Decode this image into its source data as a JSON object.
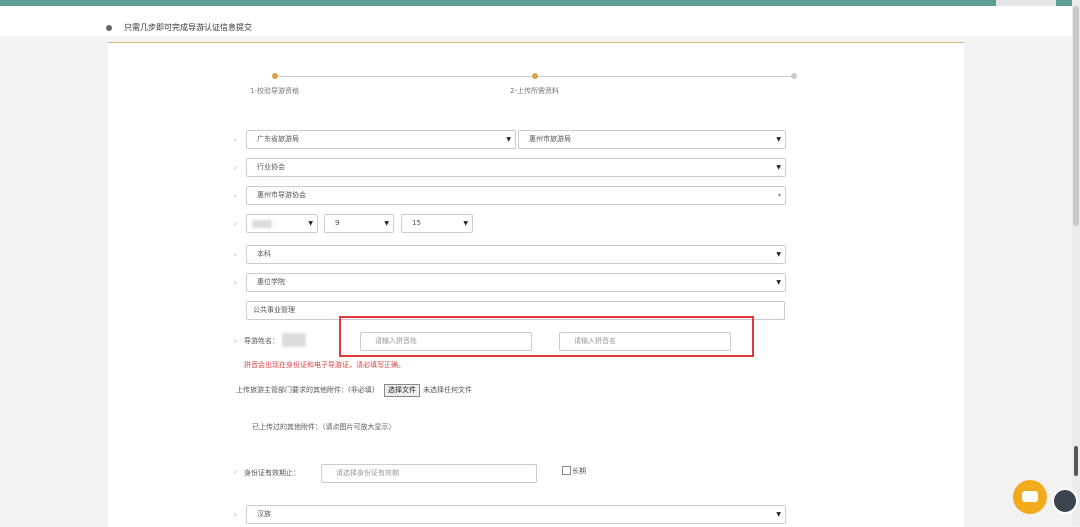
{
  "header": {
    "title": "只需几步即可完成导游认证信息提交"
  },
  "steps": [
    {
      "label": "1-校验导游资格"
    },
    {
      "label": "2-上传所需资料"
    },
    {
      "label": ""
    }
  ],
  "form": {
    "province_bureau": "广东省旅游局",
    "city_bureau": "惠州市旅游局",
    "affiliation": "行业协会",
    "association": "惠州市导游协会",
    "date_month": "9",
    "date_day": "15",
    "education": "本科",
    "school": "惠位学院",
    "major": "公共事业管理",
    "name_label": "导游姓名：",
    "pinyin_placeholder": "请输入拼音姓",
    "pinyin_placeholder2": "请输入拼音名",
    "name_warning": "拼音会出现在身份证和电子导游证，请必填写正确。",
    "upload_label": "上传旅游主管部门要求的其他附件：(非必填)",
    "file_button": "选择文件",
    "file_status": "未选择任何文件",
    "uploaded_label": "已上传过的其他附件：（请点图片可放大显示）",
    "id_expiry_label": "身份证有效期止：",
    "id_expiry_placeholder": "请选择身份证有效期",
    "long_term": "长期",
    "ethnicity": "汉族"
  },
  "colors": {
    "accent": "#d9a045",
    "warning": "#e04444",
    "topbar": "#5d9e94",
    "chat": "#f2ab1d"
  }
}
